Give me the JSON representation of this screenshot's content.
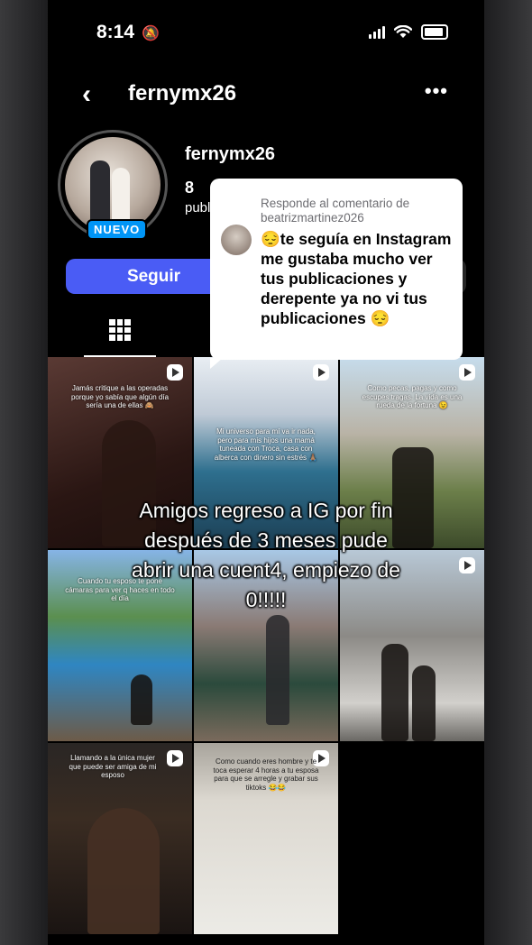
{
  "status_bar": {
    "time": "8:14"
  },
  "header": {
    "back_icon": "‹",
    "title": "fernymx26",
    "more_icon": "•••"
  },
  "profile": {
    "username": "fernymx26",
    "badge": "NUEVO",
    "posts_count": "8",
    "posts_label": "publ",
    "follow_label": "Seguir"
  },
  "comment_reply": {
    "label": "Responde al comentario de beatrizmartinez026",
    "text": "😔te seguía en Instagram me gustaba mucho ver tus publicaciones y derepente ya no vi tus publicaciones 😔"
  },
  "posts": [
    {
      "caption": "Jamás critique a las operadas porque yo sabía que algún día sería una de ellas 🙈"
    },
    {
      "caption": "Mi universo para mí va ir nada, pero para mis hijos una mamá tuneada con Troca, casa con alberca con dinero sin estrés 🙏🏽"
    },
    {
      "caption": "Como pecas, pagas y como escupes tragas. La vida es una rueda de la fortuna 😉"
    },
    {
      "caption": "Cuando tu esposo te pone cámaras para ver q haces en todo el día"
    },
    {
      "caption": ""
    },
    {
      "caption": ""
    },
    {
      "caption": "Llamando a la única mujer que puede ser amiga de mi esposo"
    },
    {
      "caption": "Como cuando eres hombre y te toca esperar 4 horas a tu esposa para que se arregle y grabar sus tiktoks 😂😂"
    }
  ],
  "overlay_text": "Amigos regreso a IG por fin\ndespués de 3 meses  pude\nabrir una cuent4, empiezo de\n0!!!!!"
}
